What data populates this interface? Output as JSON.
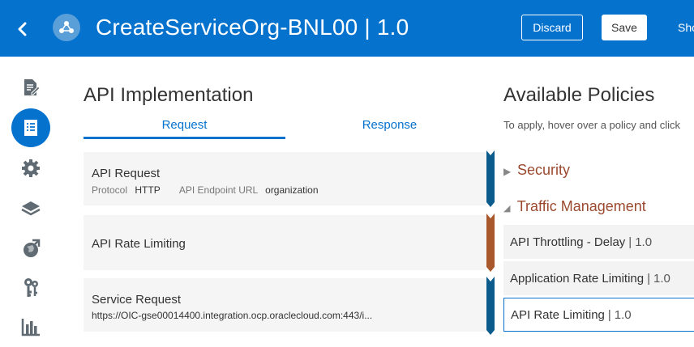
{
  "header": {
    "title": "CreateServiceOrg-BNL00 | 1.0",
    "discard_label": "Discard",
    "save_label": "Save",
    "show_label": "Sho",
    "back_icon": "chevron-left-icon",
    "logo_icon": "api-hub-icon"
  },
  "leftnav": {
    "items": [
      {
        "icon": "document-edit-icon",
        "active": false
      },
      {
        "icon": "api-implementation-icon",
        "active": true
      },
      {
        "icon": "gear-icon",
        "active": false
      },
      {
        "icon": "layers-icon",
        "active": false
      },
      {
        "icon": "globe-publish-icon",
        "active": false
      },
      {
        "icon": "keys-icon",
        "active": false
      },
      {
        "icon": "analytics-chart-icon",
        "active": false
      }
    ]
  },
  "implementation": {
    "title": "API Implementation",
    "tabs": [
      {
        "label": "Request",
        "active": true
      },
      {
        "label": "Response",
        "active": false
      }
    ],
    "cards": [
      {
        "title": "API Request",
        "protocol_key": "Protocol",
        "protocol_val": "HTTP",
        "endpoint_key": "API Endpoint URL",
        "endpoint_val": "organization",
        "flow_color": "#0b5b8c"
      },
      {
        "title": "API Rate Limiting",
        "flow_color": "#a8582a"
      },
      {
        "title": "Service Request",
        "url": "https://OIC-gse00014400.integration.ocp.oraclecloud.com:443/i...",
        "flow_color": "#0b5b8c"
      }
    ]
  },
  "policies": {
    "title": "Available Policies",
    "hint": "To apply, hover over a policy and click",
    "groups": [
      {
        "label": "Security",
        "expanded": false
      },
      {
        "label": "Traffic Management",
        "expanded": true
      }
    ],
    "items": [
      {
        "name": "API Throttling - Delay",
        "version": "1.0",
        "selected": false
      },
      {
        "name": "Application Rate Limiting",
        "version": "1.0",
        "selected": false
      },
      {
        "name": "API Rate Limiting",
        "version": "1.0",
        "selected": true
      }
    ],
    "sep": "|"
  },
  "colors": {
    "brand_blue": "#0572ce",
    "policy_group": "#9b4a2f",
    "flow_blue": "#0b5b8c",
    "flow_orange": "#a8582a"
  }
}
